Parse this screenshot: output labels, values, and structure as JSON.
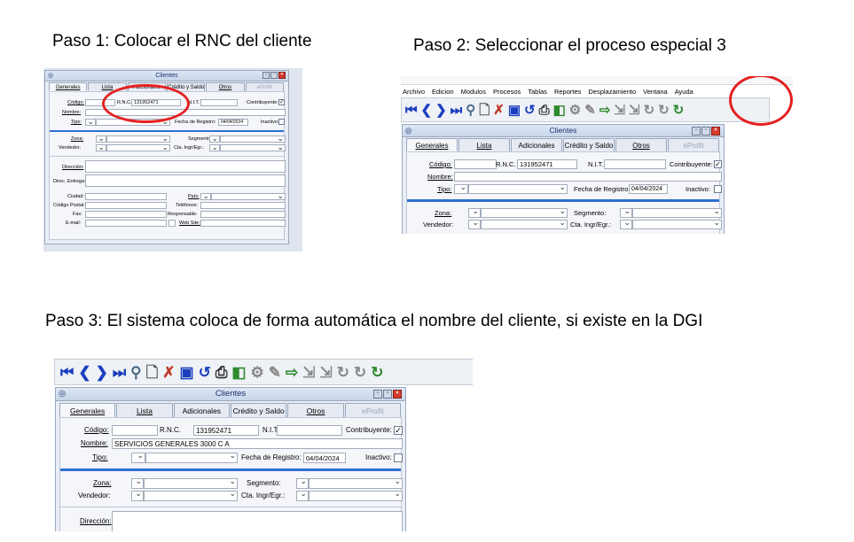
{
  "step1": {
    "title": "Paso 1: Colocar el RNC del cliente",
    "window_title": "Clientes",
    "tabs": [
      "Generales",
      "Lista",
      "Adicionales",
      "Crédito y Saldo",
      "Otros",
      "eProfit"
    ],
    "labels": {
      "codigo": "Código:",
      "rnc": "R.N.C.",
      "rnc_value": "131952471",
      "nit": "N.I.T.",
      "contribuyente": "Contribuyente:",
      "nombre": "Nombre:",
      "tipo": "Tipo:",
      "fecha_registro": "Fecha de Registro:",
      "fecha_value": "04/04/2024",
      "inactivo": "Inactivo:",
      "zona": "Zona:",
      "segmento": "Segmento:",
      "vendedor": "Vendedor:",
      "cta": "Cta. Ingr/Egr.:",
      "direccion": "Dirección:",
      "direc_entrega": "Direc. Entrega:",
      "ciudad": "Ciudad:",
      "pais": "País:",
      "codigo_postal": "Código Postal:",
      "telefonos": "Teléfonos:",
      "fax": "Fax:",
      "responsable": "Responsable:",
      "email": "E-mail:",
      "web": "Web Site:"
    }
  },
  "step2": {
    "title": "Paso 2: Seleccionar el proceso especial 3",
    "menu": [
      "Archivo",
      "Edicion",
      "Modulos",
      "Procesos",
      "Tablas",
      "Reportes",
      "Desplazamiento",
      "Ventana",
      "Ayuda"
    ],
    "window_title": "Clientes",
    "tabs": [
      "Generales",
      "Lista",
      "Adicionales",
      "Crédito y Saldo",
      "Otros",
      "eProfit"
    ],
    "labels": {
      "codigo": "Código:",
      "rnc": "R.N.C.",
      "rnc_value": "131952471",
      "nit": "N.I.T.",
      "contribuyente": "Contribuyente:",
      "nombre": "Nombre:",
      "tipo": "Tipo:",
      "fecha_registro": "Fecha de Registro:",
      "fecha_value": "04/04/2024",
      "inactivo": "Inactivo:",
      "zona": "Zona:",
      "segmento": "Segmento:",
      "vendedor": "Vendedor:",
      "cta": "Cta. Ingr/Egr.:"
    }
  },
  "step3": {
    "title": "Paso 3: El sistema coloca de forma automática el nombre del cliente, si existe en la DGI",
    "window_title": "Clientes",
    "tabs": [
      "Generales",
      "Lista",
      "Adicionales",
      "Crédito y Saldo",
      "Otros",
      "eProfit"
    ],
    "labels": {
      "codigo": "Código:",
      "rnc": "R.N.C.",
      "rnc_value": "131952471",
      "nit": "N.I.T.",
      "contribuyente": "Contribuyente:",
      "nombre": "Nombre:",
      "nombre_value": "SERVICIOS GENERALES 3000 C A",
      "tipo": "Tipo:",
      "fecha_registro": "Fecha de Registro:",
      "fecha_value": "04/04/2024",
      "inactivo": "Inactivo:",
      "zona": "Zona:",
      "segmento": "Segmento:",
      "vendedor": "Vendedor:",
      "cta": "Cta. Ingr/Egr.:",
      "direccion": "Dirección:"
    }
  },
  "toolbar_icons": [
    "first-record-icon",
    "previous-record-icon",
    "next-record-icon",
    "last-record-icon",
    "search-icon",
    "new-document-icon",
    "delete-icon",
    "save-icon",
    "undo-icon",
    "print-icon",
    "exit-icon",
    "special-process-1-icon",
    "tools-icon",
    "export-icon",
    "import-icon",
    "import-2-icon",
    "special-process-2-icon",
    "special-process-3-icon",
    "special-process-4-icon"
  ],
  "colors": {
    "highlight_circle": "#e52020",
    "accent_bar": "#2f6fd0",
    "nav_arrow": "#1b3fbf"
  }
}
